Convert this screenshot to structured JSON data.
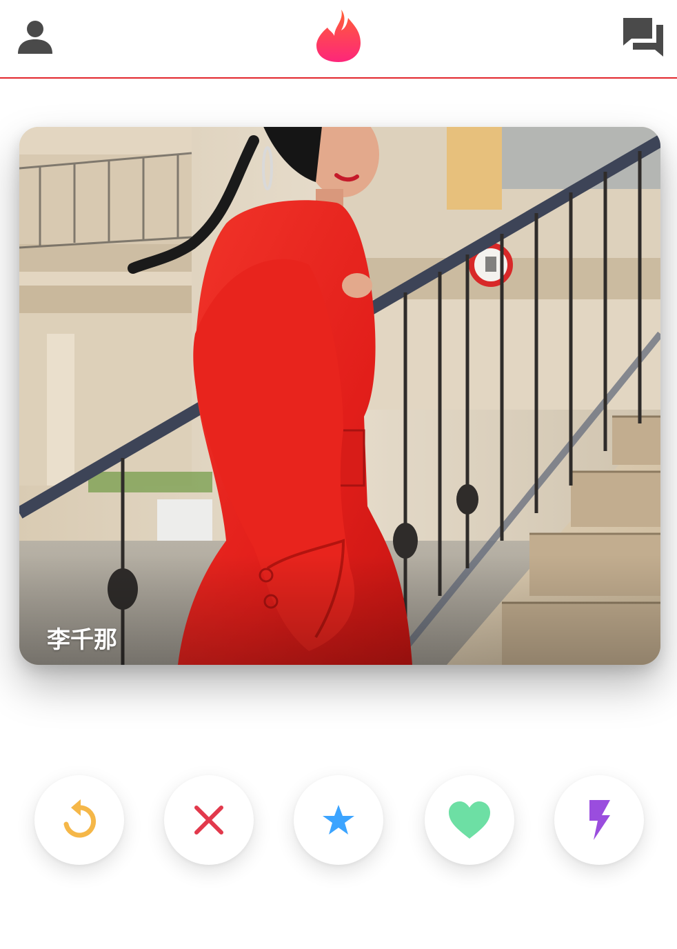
{
  "header": {
    "profile_icon": "person-icon",
    "logo_icon": "flame-logo-icon",
    "messages_icon": "chat-bubbles-icon",
    "accent_color": "#e2262c",
    "logo_gradient": [
      "#fd267a",
      "#ff6036"
    ]
  },
  "card": {
    "name": "李千那",
    "photo_description_icon": "profile-photo"
  },
  "actions": [
    {
      "key": "rewind",
      "icon": "rewind-icon",
      "color": "#f5b748"
    },
    {
      "key": "nope",
      "icon": "x-icon",
      "color": "#e2394c"
    },
    {
      "key": "super_like",
      "icon": "star-icon",
      "color": "#3ca4ff"
    },
    {
      "key": "like",
      "icon": "heart-icon",
      "color": "#6ddfa4"
    },
    {
      "key": "boost",
      "icon": "bolt-icon",
      "color": "#9a4dde"
    }
  ]
}
